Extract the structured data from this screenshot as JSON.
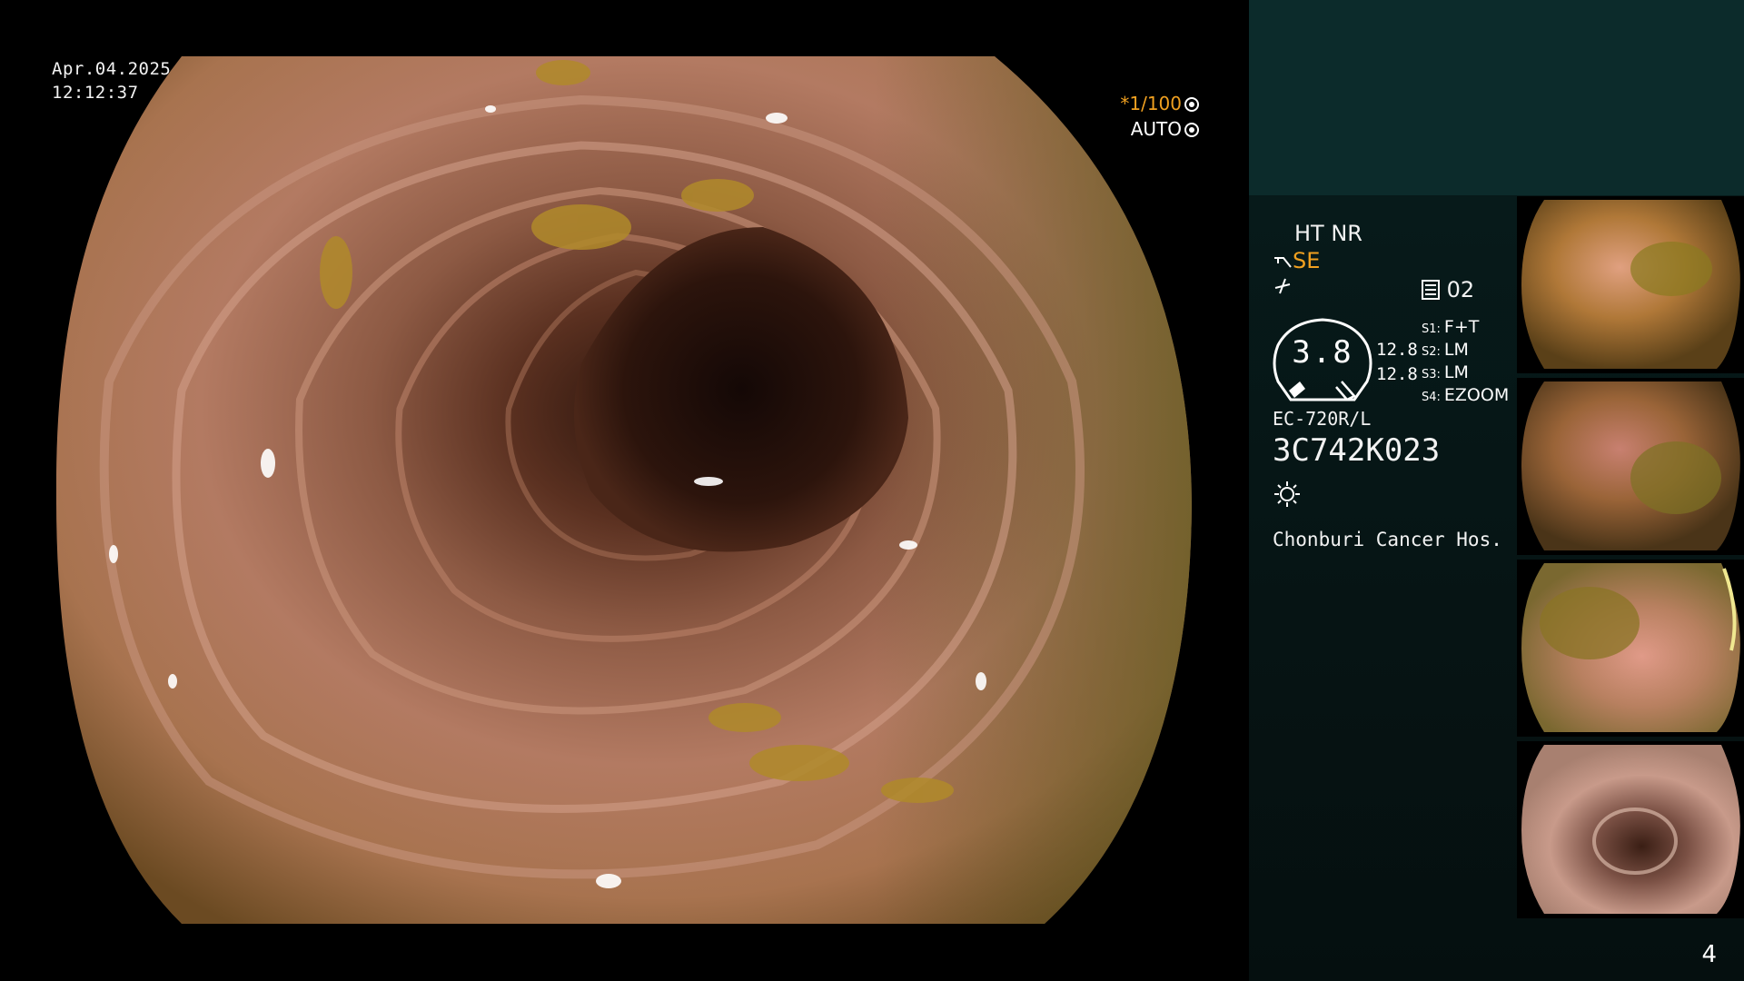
{
  "overlay": {
    "date": "Apr.04.2025",
    "time": "12:12:37",
    "shutter_label": "*1/100",
    "iris_label": "AUTO"
  },
  "panel": {
    "mode_line": "HT NR",
    "structure_enhance": "SE",
    "color_mode": "02",
    "gauge_value": "3.8",
    "side_value_1": "12.8",
    "side_value_2": "12.8",
    "presets": [
      {
        "key": "S1:",
        "value": "F+T"
      },
      {
        "key": "S2:",
        "value": "LM"
      },
      {
        "key": "S3:",
        "value": "LM"
      },
      {
        "key": "S4:",
        "value": "EZOOM"
      }
    ],
    "scope_model": "EC-720R/L",
    "scope_serial": "3C742K023",
    "hospital": "Chonburi Cancer Hos.",
    "page_number": "4"
  },
  "icons": {
    "shutter": "aperture-icon",
    "iris": "iris-icon",
    "structure": "structure-enhance-icon",
    "color": "color-mode-icon",
    "light": "light-icon"
  },
  "colors": {
    "accent": "#f0a020",
    "panel_top": "#0c2b2b",
    "panel_body": "#061414"
  }
}
